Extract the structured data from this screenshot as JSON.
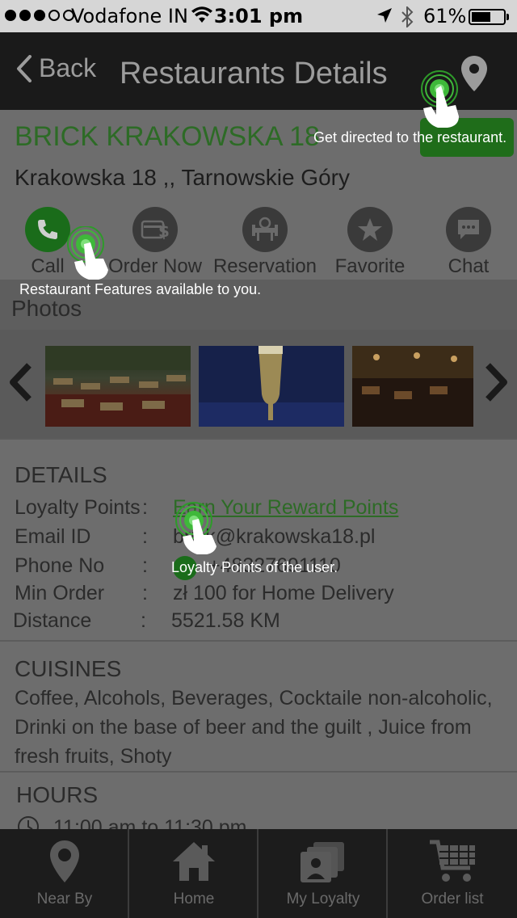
{
  "status_bar": {
    "carrier": "Vodafone IN",
    "time": "3:01 pm",
    "battery": "61%"
  },
  "nav": {
    "back_label": "Back",
    "title": "Restaurants Details"
  },
  "restaurant": {
    "name": "BRICK KRAKOWSKA 18",
    "address": "Krakowska 18 ,, Tarnowskie Góry"
  },
  "features": [
    {
      "label": "Call"
    },
    {
      "label": "Order Now"
    },
    {
      "label": "Reservation"
    },
    {
      "label": "Favorite"
    },
    {
      "label": "Chat"
    }
  ],
  "photos": {
    "title": "Photos"
  },
  "details": {
    "title": "DETAILS",
    "loyalty_label": "Loyalty Points",
    "loyalty_value": "Earn Your Reward Points",
    "email_label": "Email ID",
    "email_value": "brick@krakowska18.pl",
    "phone_label": "Phone No",
    "phone_value": "+48327691110",
    "min_order_label": "Min Order",
    "min_order_value": "zł 100 for Home Delivery",
    "distance_label": "Distance",
    "distance_value": "5521.58 KM",
    "colon": ":"
  },
  "cuisines": {
    "title": "CUISINES",
    "text": " Coffee, Alcohols, Beverages, Cocktaile non-alcoholic, Drinki on the base of beer and the guilt , Juice from fresh fruits, Shoty"
  },
  "hours": {
    "title": "HOURS",
    "text": "11:00 am to 11:30 pm"
  },
  "tabs": [
    {
      "label": "Near By"
    },
    {
      "label": "Home"
    },
    {
      "label": "My Loyalty"
    },
    {
      "label": "Order list"
    }
  ],
  "coach_marks": {
    "directions": "Get directed to the restaurant.",
    "features": "Restaurant Features available to you.",
    "loyalty": "Loyalty Points of the user."
  },
  "colors": {
    "accent_green": "#2d6b26",
    "nav_background": "#1a1a1a",
    "tab_background": "#1c1c1c"
  }
}
